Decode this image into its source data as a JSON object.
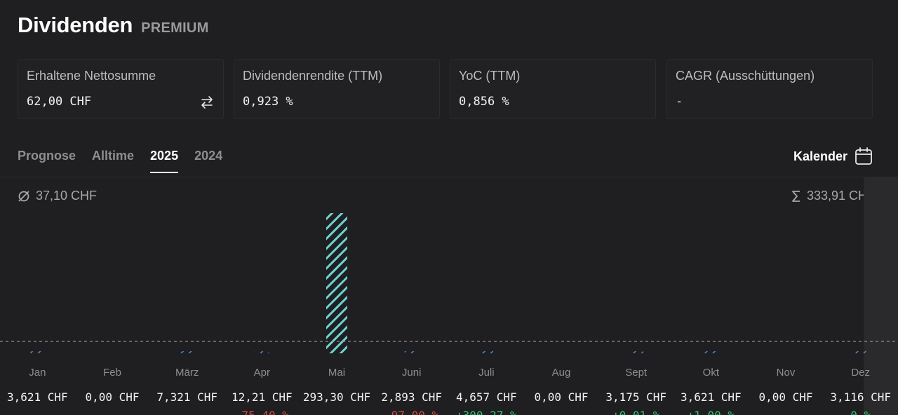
{
  "header": {
    "title": "Dividenden",
    "badge": "PREMIUM"
  },
  "cards": [
    {
      "label": "Erhaltene Nettosumme",
      "value": "62,00 CHF",
      "icon": "swap-arrows-icon"
    },
    {
      "label": "Dividendenrendite (TTM)",
      "value": "0,923 %"
    },
    {
      "label": "YoC (TTM)",
      "value": "0,856 %"
    },
    {
      "label": "CAGR (Ausschüttungen)",
      "value": "-"
    }
  ],
  "tabs": [
    {
      "label": "Prognose",
      "active": false
    },
    {
      "label": "Alltime",
      "active": false
    },
    {
      "label": "2025",
      "active": true
    },
    {
      "label": "2024",
      "active": false
    }
  ],
  "calendar": {
    "label": "Kalender",
    "icon": "calendar-icon"
  },
  "summary": {
    "average_icon": "diameter-icon",
    "average": "37,10 CHF",
    "sum_icon": "sigma-icon",
    "sum": "333,91 CHF"
  },
  "colors": {
    "bar_major": "#6fd3d3",
    "bar_minor": "#4f8fd8",
    "positive": "#2ecc71",
    "negative": "#e0483e",
    "highlight_column": "#2a2a2c"
  },
  "chart_data": {
    "type": "bar",
    "categories": [
      "Jan",
      "Feb",
      "März",
      "Apr",
      "Mai",
      "Juni",
      "Juli",
      "Aug",
      "Sept",
      "Okt",
      "Nov",
      "Dez"
    ],
    "values": [
      3.621,
      0.0,
      7.321,
      12.21,
      293.3,
      2.893,
      4.657,
      0.0,
      3.175,
      3.621,
      0.0,
      3.116
    ],
    "value_labels": [
      "3,621 CHF",
      "0,00 CHF",
      "7,321 CHF",
      "12,21 CHF",
      "293,30 CHF",
      "2,893 CHF",
      "4,657 CHF",
      "0,00 CHF",
      "3,175 CHF",
      "3,621 CHF",
      "0,00 CHF",
      "3,116 CHF"
    ],
    "change_labels": [
      "",
      "",
      "",
      "-75,40 %",
      "",
      "-97,00 %",
      "+300,27 %",
      "",
      "+0,01 %",
      "+1,00 %",
      "",
      "0 %"
    ],
    "change_signs": [
      "",
      "",
      "",
      "negative",
      "",
      "negative",
      "positive",
      "",
      "positive",
      "positive",
      "",
      "positive"
    ],
    "average_line": 37.1,
    "highlighted_month": "Dez",
    "fill": "hatched"
  }
}
